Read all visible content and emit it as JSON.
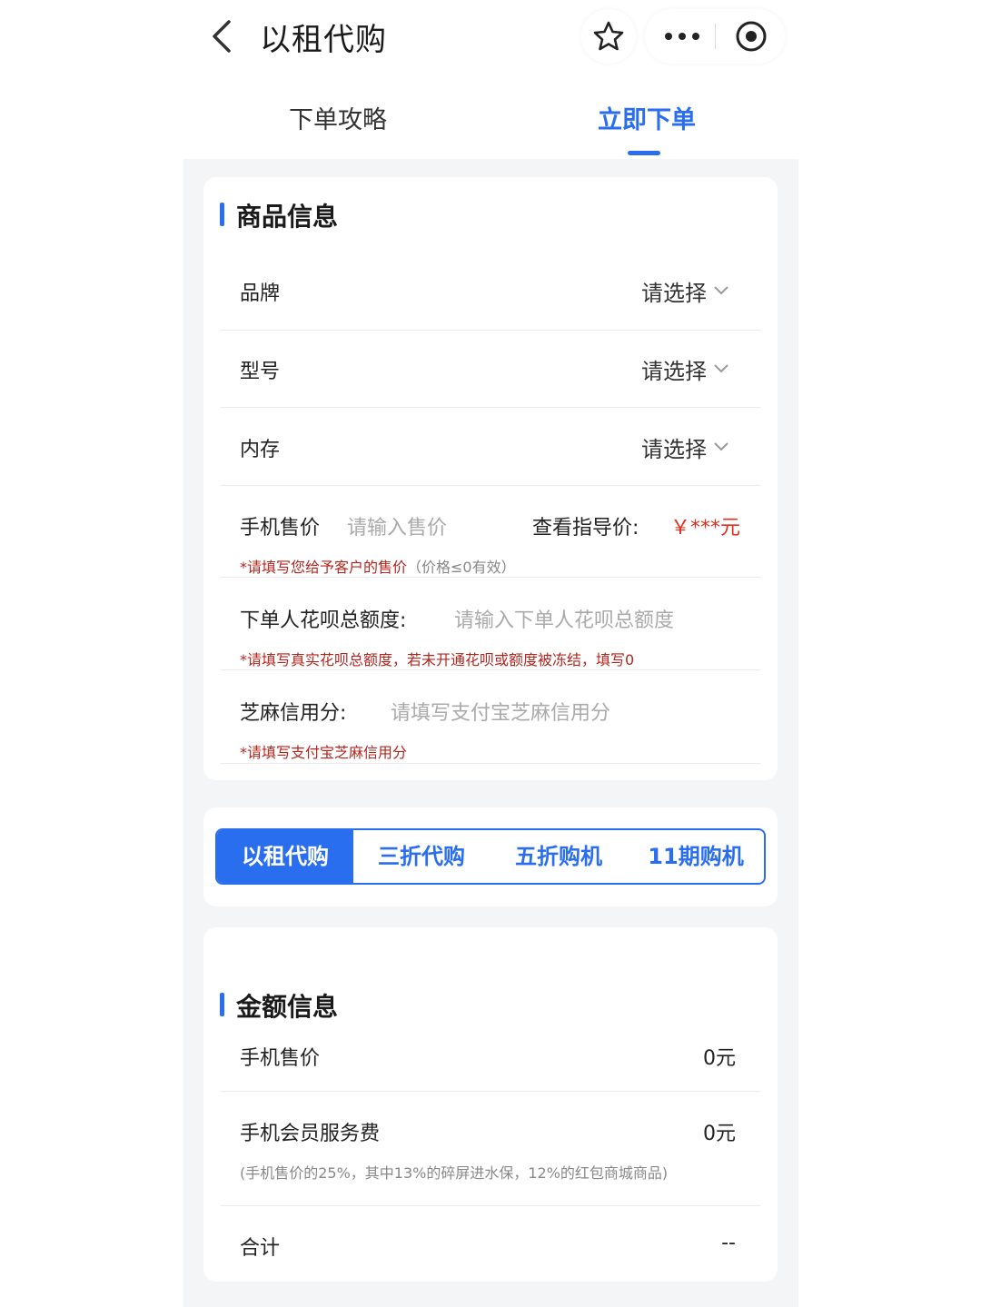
{
  "header": {
    "title": "以租代购"
  },
  "tabs": {
    "guide": "下单攻略",
    "order": "立即下单"
  },
  "product_info": {
    "title": "商品信息",
    "rows": [
      {
        "label": "品牌",
        "value": "请选择"
      },
      {
        "label": "型号",
        "value": "请选择"
      },
      {
        "label": "内存",
        "value": "请选择"
      }
    ],
    "price": {
      "label": "手机售价",
      "placeholder": "请输入售价",
      "guide_label": "查看指导价:",
      "guide_value": "￥***元",
      "hint": "*请填写您给予客户的售价",
      "hint_note": "（价格≤0有效）"
    },
    "huabei": {
      "label": "下单人花呗总额度:",
      "placeholder": "请输入下单人花呗总额度",
      "hint": "*请填写真实花呗总额度，若未开通花呗或额度被冻结，填写0"
    },
    "sesame": {
      "label": "芝麻信用分:",
      "placeholder": "请填写支付宝芝麻信用分",
      "hint": "*请填写支付宝芝麻信用分"
    }
  },
  "plan_tabs": [
    "以租代购",
    "三折代购",
    "五折购机",
    "11期购机"
  ],
  "amount_info": {
    "title": "金额信息",
    "price_label": "手机售价",
    "price_value": "0元",
    "fee_label": "手机会员服务费",
    "fee_value": "0元",
    "fee_note": "(手机售价的25%，其中13%的碎屏进水保，12%的红包商城商品)",
    "total_label": "合计",
    "total_value": "--"
  },
  "colors": {
    "accent": "#2a6ef0",
    "warning": "#b3261e",
    "price_red": "#e0301e"
  }
}
